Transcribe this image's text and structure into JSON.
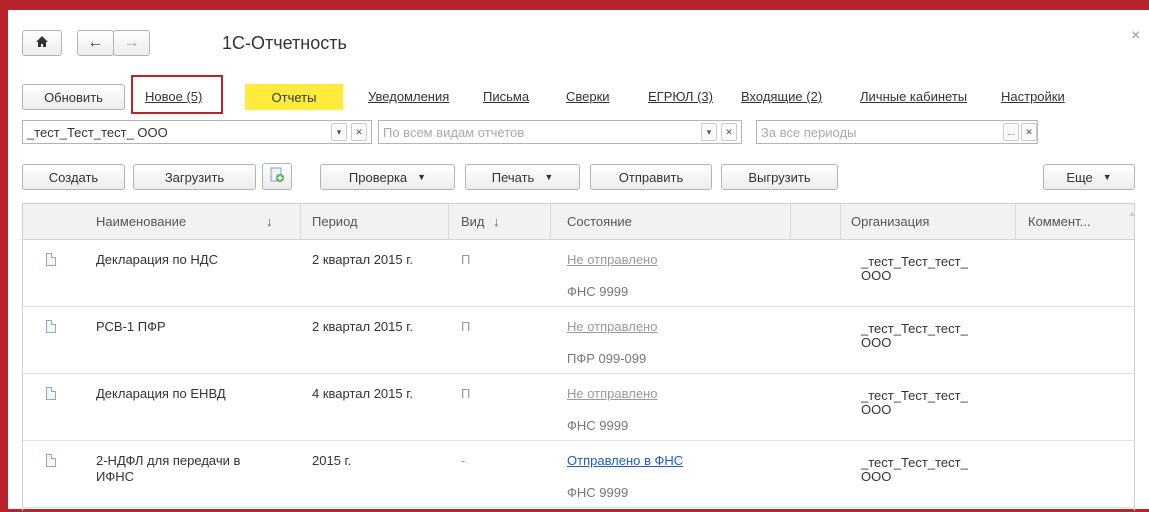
{
  "window": {
    "title": "1С-Отчетность",
    "close": "×",
    "home_icon": "home-icon",
    "back": "←",
    "forward": "→"
  },
  "tabs": {
    "refresh": "Обновить",
    "items": [
      "Новое (5)",
      "Отчеты",
      "Уведомления",
      "Письма",
      "Сверки",
      "ЕГРЮЛ (3)",
      "Входящие (2)",
      "Личные кабинеты",
      "Настройки"
    ],
    "active": "Отчеты",
    "highlight": "#b8242b",
    "active_bg": "#ffeb3b"
  },
  "filters": {
    "organization": "_тест_Тест_тест_ ООО",
    "report_type_placeholder": "По всем видам отчетов",
    "period_placeholder": "За все периоды"
  },
  "toolbar": {
    "create": "Создать",
    "load": "Загрузить",
    "check": "Проверка",
    "print": "Печать",
    "send": "Отправить",
    "export": "Выгрузить",
    "more": "Еще"
  },
  "table": {
    "columns": {
      "name": "Наименование",
      "name_sort": "↓",
      "period": "Период",
      "type": "Вид",
      "type_sort": "↓",
      "status": "Состояние",
      "organization": "Организация",
      "comment": "Коммент..."
    },
    "rows": [
      {
        "name": "Декларация по НДС",
        "name2": "",
        "period": "2 квартал 2015 г.",
        "type": "П",
        "status": "Не отправлено",
        "status_color": "#9a9a9a",
        "recipient": "ФНС 9999",
        "org1": "_тест_Тест_тест_",
        "org2": "ООО"
      },
      {
        "name": "РСВ-1 ПФР",
        "name2": "",
        "period": "2 квартал 2015 г.",
        "type": "П",
        "status": "Не отправлено",
        "status_color": "#9a9a9a",
        "recipient": "ПФР 099-099",
        "org1": "_тест_Тест_тест_",
        "org2": "ООО"
      },
      {
        "name": "Декларация по ЕНВД",
        "name2": "",
        "period": "4 квартал 2015 г.",
        "type": "П",
        "status": "Не отправлено",
        "status_color": "#9a9a9a",
        "recipient": "ФНС 9999",
        "org1": "_тест_Тест_тест_",
        "org2": "ООО"
      },
      {
        "name": "2-НДФЛ для передачи в",
        "name2": "ИФНС",
        "period": "2015 г.",
        "type": "-",
        "status": "Отправлено в ФНС",
        "status_color": "#1f5fb8",
        "recipient": "ФНС 9999",
        "org1": "_тест_Тест_тест_",
        "org2": "ООО"
      }
    ]
  }
}
